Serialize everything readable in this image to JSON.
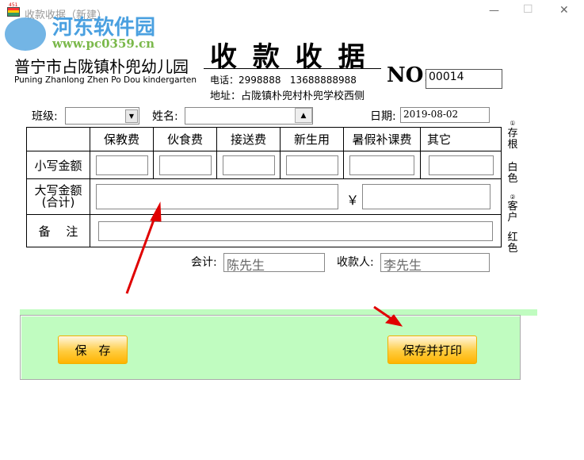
{
  "window": {
    "title": "收款收据（新建）",
    "icon_badge": "451",
    "minimize": "—",
    "maximize": "☐",
    "close": "✕"
  },
  "watermark": {
    "name": "河东软件园",
    "url": "www.pc0359.cn"
  },
  "header": {
    "school_cn": "普宁市占陇镇朴兜幼儿园",
    "school_en": "Puning Zhanlong Zhen Po Dou kindergarten",
    "title": "收 款 收 据",
    "phone_label": "电话：",
    "phone1": "2998888",
    "phone2": "13688888988",
    "address_label": "地址：",
    "address": "占陇镇朴兜村朴兜学校西侧",
    "no_label": "NO:",
    "no_value": "00014"
  },
  "form": {
    "class_label": "班级:",
    "class_value": "",
    "name_label": "姓名:",
    "name_value": "",
    "date_label": "日期:",
    "date_value": "2019-08-02"
  },
  "table": {
    "columns": [
      "保教费",
      "伙食费",
      "接送费",
      "新生用",
      "暑假补课费",
      "其它"
    ],
    "row_small": "小写金额",
    "row_big_1": "大写金额",
    "row_big_2": "(合计)",
    "yen": "￥",
    "row_note": "备　 注"
  },
  "sign": {
    "accountant_label": "会计:",
    "accountant": "陈先生",
    "payee_label": "收款人:",
    "payee": "李先生"
  },
  "side": {
    "copy1_num": "①",
    "copy1": "存根",
    "copy1_color": "白色",
    "copy2_num": "②",
    "copy2": "客户",
    "copy2_color": "红色"
  },
  "buttons": {
    "save": "保　存",
    "save_print": "保存并打印"
  },
  "colors": {
    "panel": "#c0fcc0",
    "button": "#ffc020",
    "arrow": "#e00000"
  }
}
